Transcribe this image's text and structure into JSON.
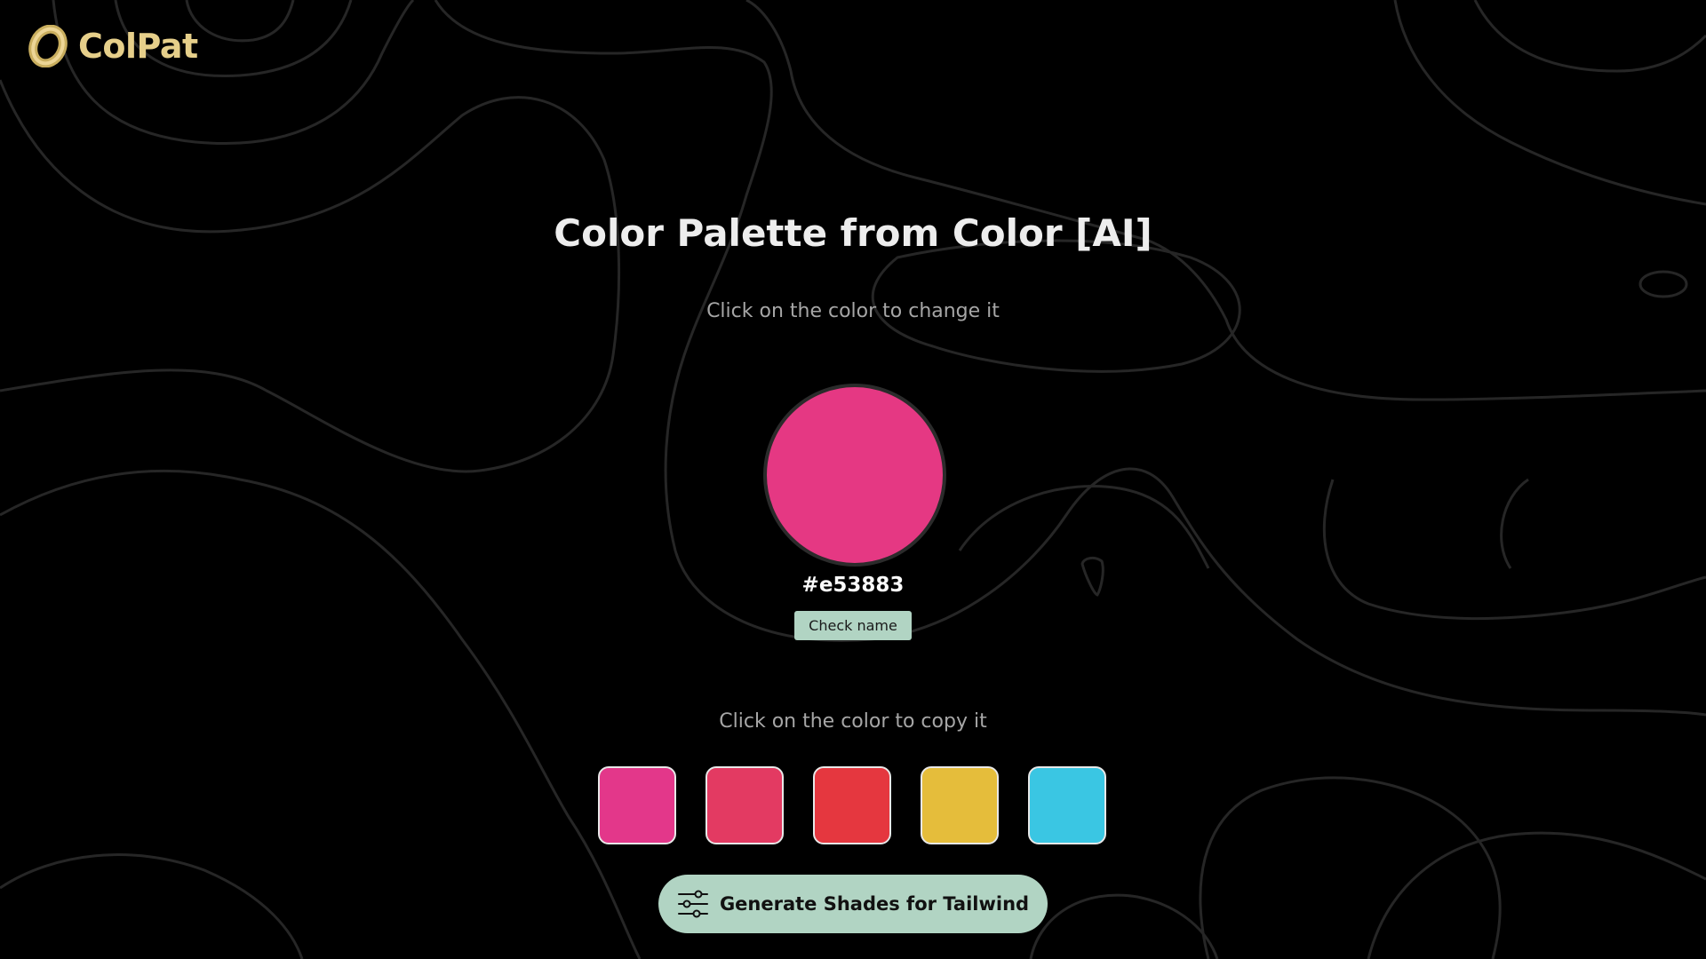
{
  "brand": {
    "name": "ColPat",
    "logo_icon": "ring-logo-icon",
    "color": "#e6cf8a"
  },
  "main": {
    "title": "Color Palette from Color [AI]",
    "change_hint": "Click on the color to change it",
    "selected_color": "#e53883",
    "hex_label": "#e53883",
    "check_name_label": "Check name",
    "copy_hint": "Click on the color to copy it",
    "palette": [
      {
        "color": "#e3378a"
      },
      {
        "color": "#e33a62"
      },
      {
        "color": "#e5373f"
      },
      {
        "color": "#e5bd3b"
      },
      {
        "color": "#3ac6e3"
      }
    ],
    "generate_label": "Generate Shades for Tailwind",
    "generate_icon": "sliders-icon"
  },
  "theme": {
    "background": "#000000",
    "button_bg": "#b1d4c3"
  }
}
